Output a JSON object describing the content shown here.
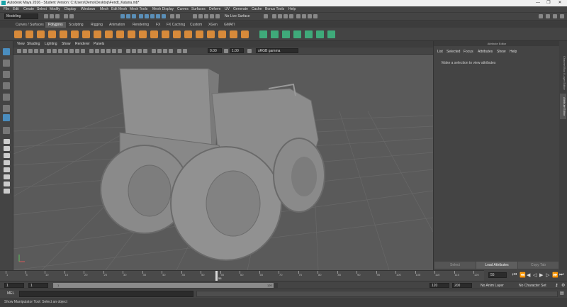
{
  "window": {
    "title": "Autodesk Maya 2016 - Student Version: C:\\Users\\Demo\\Desktop\\Fendt_Katana.mb*",
    "controls": [
      "—",
      "❐",
      "✕"
    ]
  },
  "menubar": [
    "File",
    "Edit",
    "Create",
    "Select",
    "Modify",
    "Display",
    "Windows",
    "Mesh",
    "Edit Mesh",
    "Mesh Tools",
    "Mesh Display",
    "Curves",
    "Surfaces",
    "Deform",
    "UV",
    "Generate",
    "Cache",
    "Bonus Tools",
    "Help"
  ],
  "statusline": {
    "menu_set": "Modeling",
    "no_live_surface": "No Live Surface"
  },
  "shelf_tabs": [
    "Curves / Surfaces",
    "Polygons",
    "Sculpting",
    "Rigging",
    "Animation",
    "Rendering",
    "FX",
    "FX Caching",
    "Custom",
    "XGen",
    "GMATI"
  ],
  "shelf_active_tab": "Polygons",
  "panel_menu": [
    "View",
    "Shading",
    "Lighting",
    "Show",
    "Renderer",
    "Panels"
  ],
  "panel_toolbar": {
    "field_a": "0.00",
    "field_b": "1.00",
    "color_space": "sRGB gamma"
  },
  "attribute_editor": {
    "header": "Attribute Editor",
    "menu": [
      "List",
      "Selected",
      "Focus",
      "Attributes",
      "Show",
      "Help"
    ],
    "message": "Make a selection to view attributes",
    "buttons": [
      "Select",
      "Load Attributes",
      "Copy Tab"
    ],
    "side_tabs": [
      "Channel Box / Layer Editor",
      "Attribute Editor"
    ]
  },
  "time_slider": {
    "ticks": [
      "1",
      "5",
      "10",
      "15",
      "20",
      "25",
      "30",
      "35",
      "40",
      "45",
      "50",
      "55",
      "60",
      "65",
      "70",
      "75",
      "80",
      "85",
      "90",
      "95",
      "100",
      "105",
      "110",
      "115",
      "120"
    ],
    "current_frame_label": "55",
    "current_frame": "55",
    "current_fraction": 0.45
  },
  "range_slider": {
    "start": "1",
    "inner_start": "1",
    "range_start_label": "1",
    "range_end_label": "120",
    "inner_end": "120",
    "end": "200",
    "anim_layer": "No Anim Layer",
    "character_set": "No Character Set"
  },
  "command_line": {
    "label": "MEL"
  },
  "help_line": {
    "text": "Show Manipulator Tool: Select an object"
  },
  "colors": {
    "viewport_bg": "#5a5a5a",
    "grid": "#6a6a6a",
    "model": "#8e8e8e",
    "accent": "#4a8dbf",
    "shelf_poly": "#d78a3a",
    "shelf_uv": "#3faa7a"
  }
}
